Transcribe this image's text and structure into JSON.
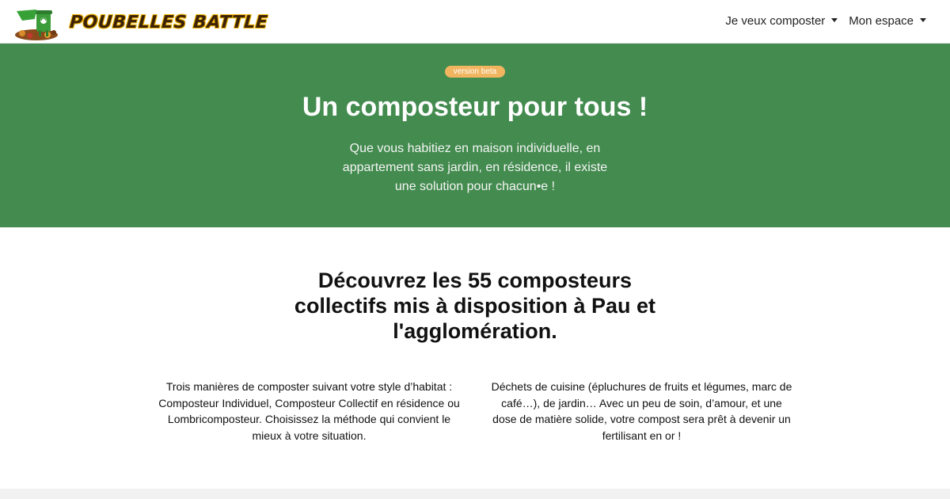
{
  "brand": {
    "name": "POUBELLES BATTLE",
    "logo_icon": "recycling-bin-mascot-icon"
  },
  "nav": {
    "items": [
      {
        "label": "Je veux composter",
        "icon": "chevron-down-icon"
      },
      {
        "label": "Mon espace",
        "icon": "chevron-down-icon"
      }
    ]
  },
  "hero": {
    "badge": "version beta",
    "title": "Un composteur pour tous !",
    "subtitle": "Que vous habitiez en maison individuelle, en appartement sans jardin, en résidence, il existe une solution pour chacun•e !"
  },
  "intro": {
    "title": "Découvrez les 55 composteurs collectifs mis à disposition à Pau et l'agglomération.",
    "left_text": "Trois manières de composter suivant votre style d’habitat : Composteur Individuel, Composteur Collectif en résidence ou Lombricomposteur. Choisissez la méthode qui convient le mieux à votre situation.",
    "right_text": "Déchets de cuisine (épluchures de fruits et légumes, marc de café…), de jardin… Avec un peu de soin, d’amour, et une dose de matière solide, votre compost sera prêt à devenir un fertilisant en or !"
  },
  "colors": {
    "hero_green": "#438b4f",
    "badge_orange": "#f2b55f",
    "brand_brown": "#3b2208"
  }
}
